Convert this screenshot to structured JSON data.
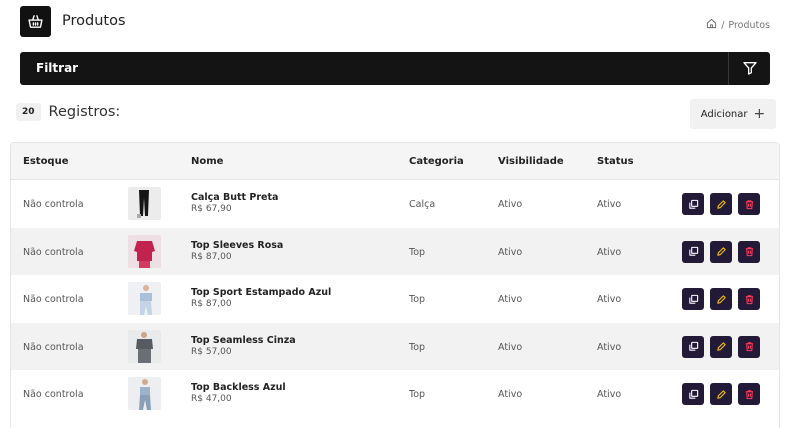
{
  "header": {
    "title": "Produtos",
    "breadcrumb_sep": "/",
    "breadcrumb_current": "Produtos"
  },
  "filter": {
    "title": "Filtrar"
  },
  "records": {
    "count": "20",
    "label": "Registros:"
  },
  "add_button": {
    "label": "Adicionar",
    "plus": "+"
  },
  "table": {
    "headers": {
      "stock": "Estoque",
      "name": "Nome",
      "category": "Categoria",
      "visibility": "Visibilidade",
      "status": "Status"
    },
    "rows": [
      {
        "stock": "Não controla",
        "name": "Calça Butt Preta",
        "price": "R$ 67,90",
        "category": "Calça",
        "visibility": "Ativo",
        "status": "Ativo",
        "thumb": "black-pants"
      },
      {
        "stock": "Não controla",
        "name": "Top Sleeves Rosa",
        "price": "R$ 87,00",
        "category": "Top",
        "visibility": "Ativo",
        "status": "Ativo",
        "thumb": "pink-top"
      },
      {
        "stock": "Não controla",
        "name": "Top Sport Estampado Azul",
        "price": "R$ 87,00",
        "category": "Top",
        "visibility": "Ativo",
        "status": "Ativo",
        "thumb": "blue-print-top"
      },
      {
        "stock": "Não controla",
        "name": "Top Seamless Cinza",
        "price": "R$ 57,00",
        "category": "Top",
        "visibility": "Ativo",
        "status": "Ativo",
        "thumb": "grey-top"
      },
      {
        "stock": "Não controla",
        "name": "Top Backless Azul",
        "price": "R$ 47,00",
        "category": "Top",
        "visibility": "Ativo",
        "status": "Ativo",
        "thumb": "blue-top"
      }
    ]
  },
  "colors": {
    "accent_dark": "#141414",
    "action_bg": "#231a38",
    "copy_icon": "#ffffff",
    "edit_icon": "#f2c200",
    "delete_icon": "#ff3b5c"
  }
}
